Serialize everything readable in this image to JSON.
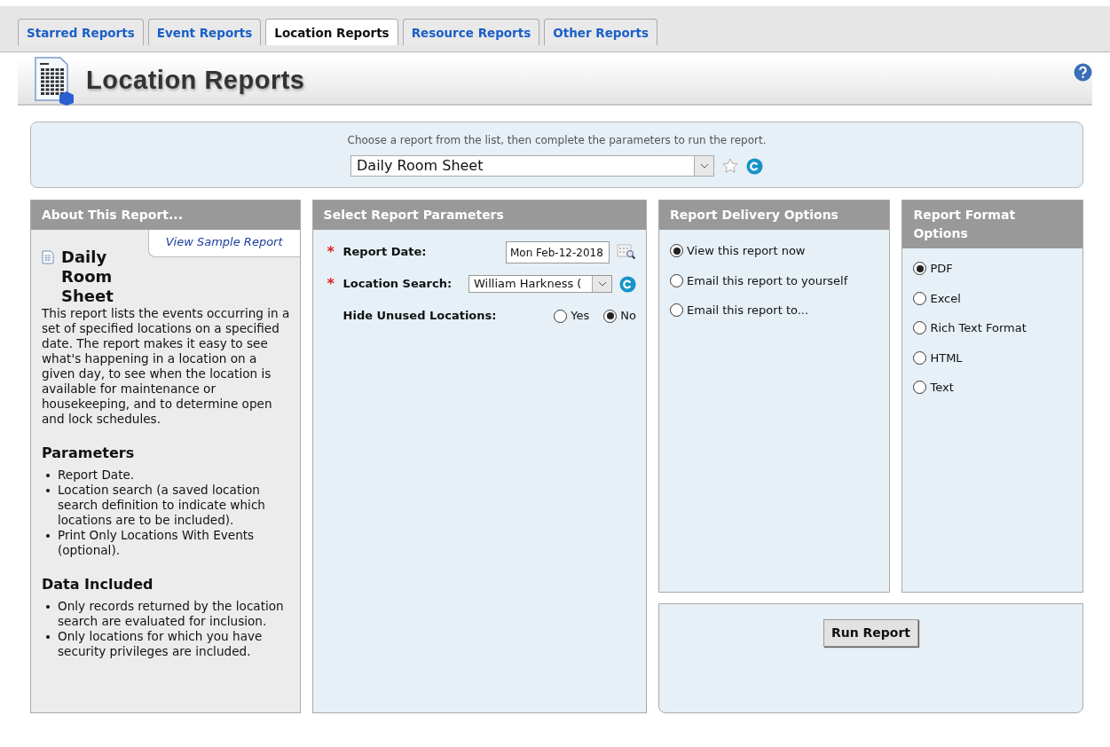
{
  "tabs": [
    {
      "label": "Starred Reports",
      "selected": false
    },
    {
      "label": "Event Reports",
      "selected": false
    },
    {
      "label": "Location Reports",
      "selected": true
    },
    {
      "label": "Resource Reports",
      "selected": false
    },
    {
      "label": "Other Reports",
      "selected": false
    }
  ],
  "header": {
    "title": "Location Reports"
  },
  "chooser": {
    "instruction": "Choose a report from the list, then complete the parameters to run the report.",
    "report": "Daily Room Sheet"
  },
  "about": {
    "heading": "About This Report...",
    "sample_link": "View Sample Report",
    "report_title": "Daily Room Sheet",
    "description": "This report lists the events occurring in a set of specified locations on a specified date. The report makes it easy to see what's happening in a location on a given day, to see when the location is available for maintenance or housekeeping, and to determine open and lock schedules.",
    "sections": [
      {
        "heading": "Parameters",
        "items": [
          "Report Date.",
          "Location search (a saved location search definition to indicate which locations are to be included).",
          "Print Only Locations With Events (optional)."
        ]
      },
      {
        "heading": "Data Included",
        "items": [
          "Only records returned by the location search are evaluated for inclusion.",
          "Only locations for which you have security privileges are included."
        ]
      }
    ]
  },
  "parameters": {
    "heading": "Select Report Parameters",
    "fields": [
      {
        "kind": "date",
        "marker": "*",
        "label": "Report Date:",
        "value": "Mon Feb-12-2018"
      },
      {
        "kind": "select",
        "marker": "*",
        "label": "Location Search:",
        "value": "William Harkness ("
      },
      {
        "kind": "radio",
        "label": "Hide Unused Locations:",
        "options": [
          {
            "label": "Yes",
            "selected": false
          },
          {
            "label": "No",
            "selected": true
          }
        ]
      }
    ]
  },
  "delivery": {
    "heading": "Report Delivery Options",
    "options": [
      {
        "label": "View this report now",
        "selected": true
      },
      {
        "label": "Email this report to yourself",
        "selected": false
      },
      {
        "label": "Email this report to...",
        "selected": false
      }
    ]
  },
  "format": {
    "heading": "Report Format Options",
    "options": [
      {
        "label": "PDF",
        "selected": true
      },
      {
        "label": "Excel",
        "selected": false
      },
      {
        "label": "Rich Text Format",
        "selected": false
      },
      {
        "label": "HTML",
        "selected": false
      },
      {
        "label": "Text",
        "selected": false
      }
    ]
  },
  "run_button": "Run Report"
}
